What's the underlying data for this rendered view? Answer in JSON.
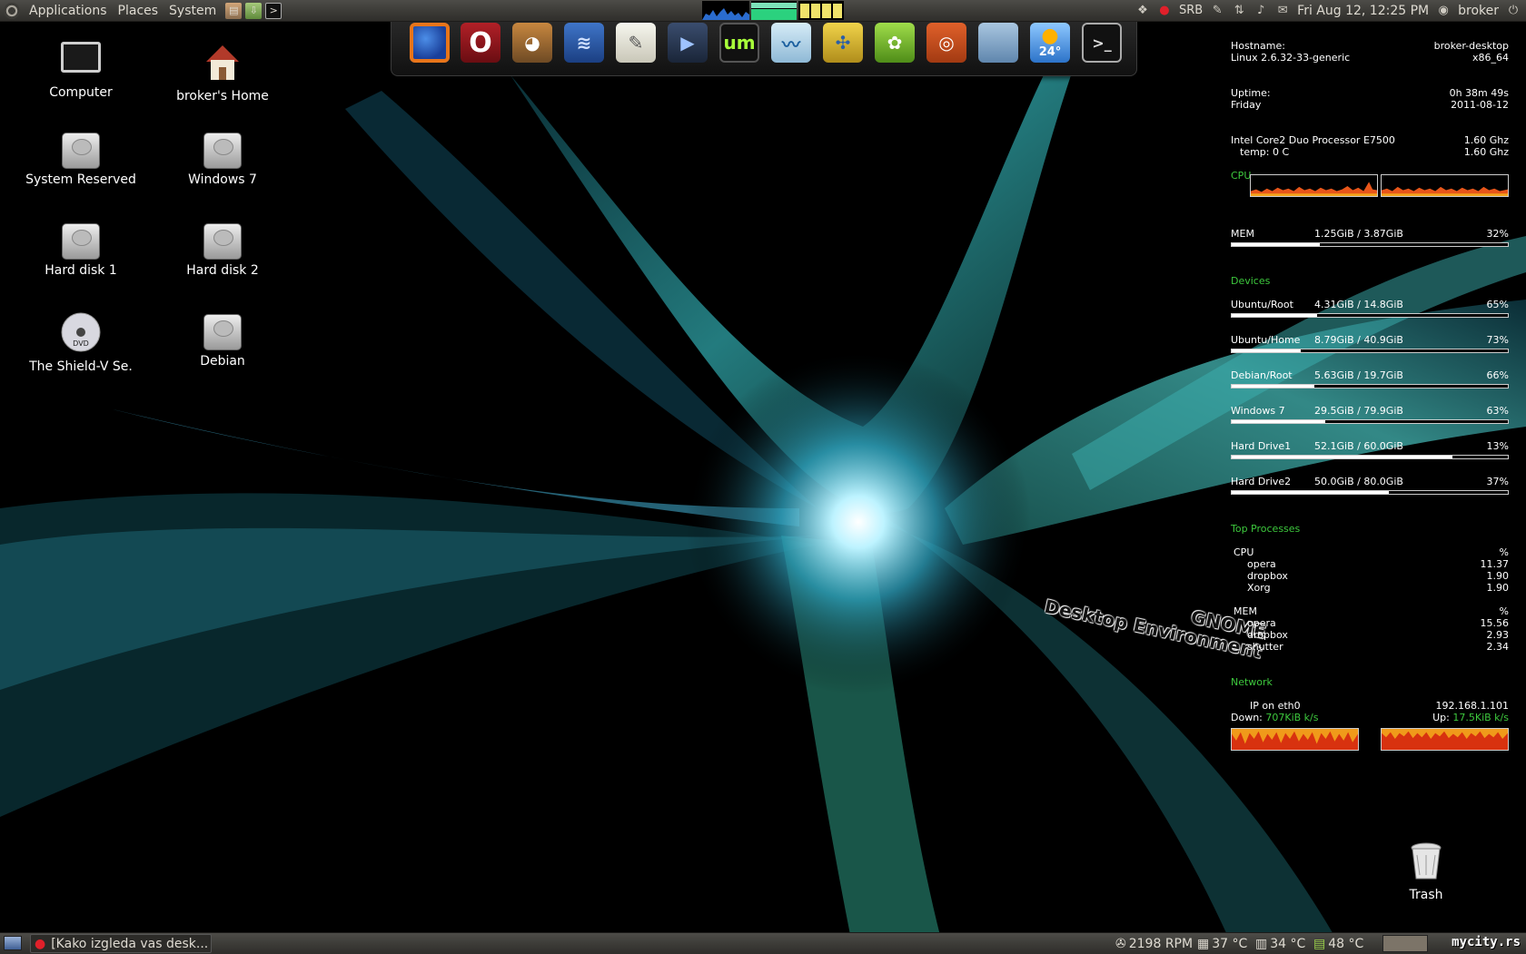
{
  "top_panel": {
    "menus": [
      "Applications",
      "Places",
      "System"
    ],
    "keyboard_layout": "SRB",
    "datetime": "Fri Aug 12, 12:25 PM",
    "user": "broker"
  },
  "dock": {
    "weather_temp": "24°",
    "apps": [
      "firefox-icon",
      "opera-icon",
      "gimp-icon",
      "writer-icon",
      "text-editor-icon",
      "video-editor-icon",
      "um-icon",
      "system-monitor-icon",
      "network-icon",
      "software-center-icon",
      "ubuntu-icon",
      "folder-icon",
      "weather-icon",
      "terminal-icon"
    ]
  },
  "desktop": {
    "icons": [
      {
        "label": "Computer"
      },
      {
        "label": "broker's Home"
      },
      {
        "label": "System Reserved"
      },
      {
        "label": "Windows 7"
      },
      {
        "label": "Hard disk 1"
      },
      {
        "label": "Hard disk 2"
      },
      {
        "label": "The Shield-V Se."
      },
      {
        "label": "Debian"
      }
    ],
    "trash_label": "Trash",
    "overlay_line1": "GNOME",
    "overlay_line2": "Desktop Environment",
    "dvd_text": "DVD"
  },
  "conky": {
    "hostname_label": "Hostname:",
    "hostname": "broker-desktop",
    "kernel": "Linux 2.6.32-33-generic",
    "arch": "x86_64",
    "uptime_label": "Uptime:",
    "uptime": "0h 38m 49s",
    "day": "Friday",
    "date": "2011-08-12",
    "cpu_model": "Intel Core2 Duo Processor E7500",
    "cpu_freq1": "1.60 Ghz",
    "temp": "temp: 0 C",
    "cpu_freq2": "1.60 Ghz",
    "cpu_label": "CPU",
    "mem_label": "MEM",
    "mem_value": "1.25GiB / 3.87GiB",
    "mem_percent": "32%",
    "mem_fill": 0.32,
    "devices_label": "Devices",
    "devices": [
      {
        "name": "Ubuntu/Root",
        "usage": "4.31GiB / 14.8GiB",
        "percent": "65%",
        "fill": 0.31
      },
      {
        "name": "Ubuntu/Home",
        "usage": "8.79GiB / 40.9GiB",
        "percent": "73%",
        "fill": 0.25
      },
      {
        "name": "Debian/Root",
        "usage": "5.63GiB / 19.7GiB",
        "percent": "66%",
        "fill": 0.3
      },
      {
        "name": "Windows 7",
        "usage": "29.5GiB / 79.9GiB",
        "percent": "63%",
        "fill": 0.34
      },
      {
        "name": "Hard Drive1",
        "usage": "52.1GiB / 60.0GiB",
        "percent": "13%",
        "fill": 0.8
      },
      {
        "name": "Hard Drive2",
        "usage": "50.0GiB / 80.0GiB",
        "percent": "37%",
        "fill": 0.57
      }
    ],
    "top_label": "Top Processes",
    "top_cpu_label": "CPU",
    "percent_sign": "%",
    "top_cpu": [
      {
        "name": "opera",
        "value": "11.37"
      },
      {
        "name": "dropbox",
        "value": "1.90"
      },
      {
        "name": "Xorg",
        "value": "1.90"
      }
    ],
    "top_mem_label": "MEM",
    "top_mem": [
      {
        "name": "opera",
        "value": "15.56"
      },
      {
        "name": "dropbox",
        "value": "2.93"
      },
      {
        "name": "shutter",
        "value": "2.34"
      }
    ],
    "network_label": "Network",
    "ip_label": "IP on eth0",
    "ip": "192.168.1.101",
    "down_label": "Down:",
    "down": "707KiB k/s",
    "up_label": "Up:",
    "up": "17.5KiB k/s"
  },
  "bottom_panel": {
    "task": "[Kako izgleda vas desk...",
    "fan": "2198 RPM",
    "temp1": "37 °C",
    "temp2": "34 °C",
    "temp3": "48 °C",
    "watermark": "mycity.rs"
  }
}
